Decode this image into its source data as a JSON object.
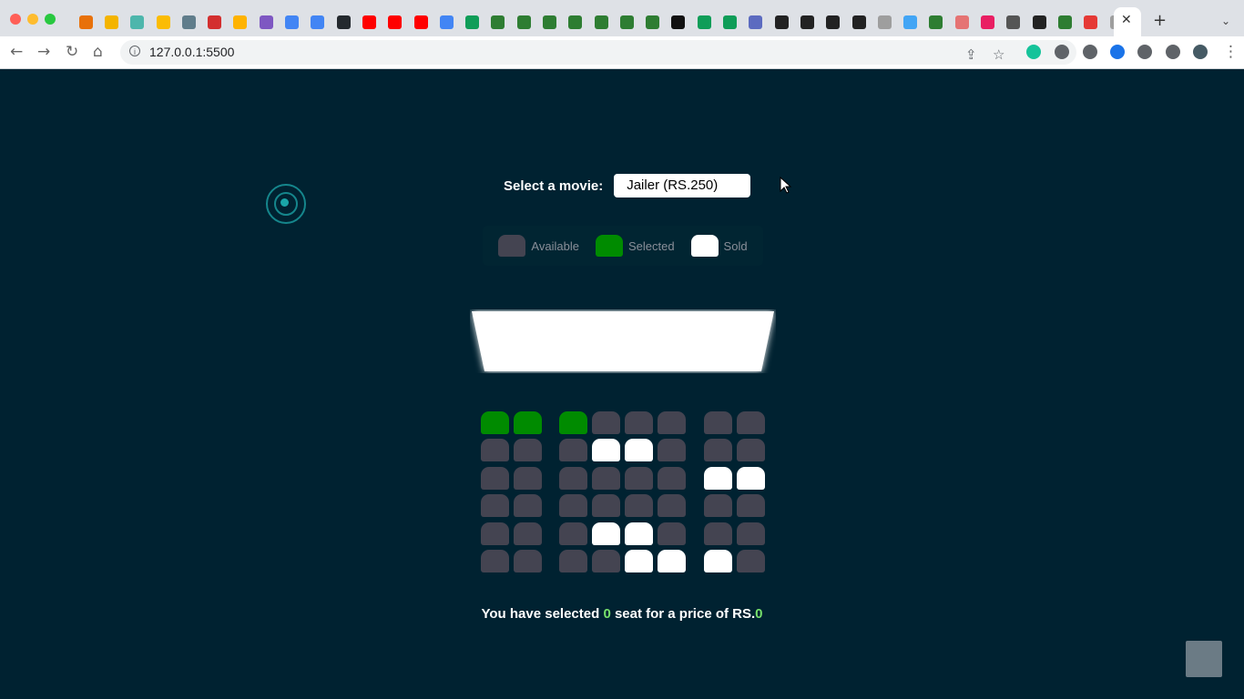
{
  "browser": {
    "url": "127.0.0.1:5500",
    "tab_icon_colors": [
      "#e8710a",
      "#f4b400",
      "#4db6ac",
      "#fbbc04",
      "#607d8b",
      "#d32f2f",
      "#ffb300",
      "#7e57c2",
      "#4285f4",
      "#4285f4",
      "#24292e",
      "#ff0000",
      "#ff0000",
      "#ff0000",
      "#4285f4",
      "#0f9d58",
      "#2e7d32",
      "#2e7d32",
      "#2e7d32",
      "#2e7d32",
      "#2e7d32",
      "#2e7d32",
      "#2e7d32",
      "#111111",
      "#0f9d58",
      "#0f9d58",
      "#5c6bc0",
      "#222222",
      "#222222",
      "#222222",
      "#222222",
      "#9e9e9e",
      "#42a5f5",
      "#2e7d32",
      "#e57373",
      "#e91e63",
      "#555555",
      "#222222",
      "#2e7d32",
      "#e53935",
      "#9e9e9e"
    ],
    "extension_colors": [
      "#15c39a",
      "#5f6368",
      "#5f6368",
      "#1a73e8",
      "#5f6368",
      "#5f6368",
      "#455a64"
    ]
  },
  "movie": {
    "label": "Select a movie:",
    "selected": "Jailer (RS.250)"
  },
  "legend": [
    {
      "label": "Available",
      "color": "#444451"
    },
    {
      "label": "Selected",
      "color": "#008b00"
    },
    {
      "label": "Sold",
      "color": "#ffffff"
    }
  ],
  "seats": {
    "rows": [
      [
        "selected",
        "selected",
        "selected",
        "available",
        "available",
        "available",
        "available",
        "available"
      ],
      [
        "available",
        "available",
        "available",
        "sold",
        "sold",
        "available",
        "available",
        "available"
      ],
      [
        "available",
        "available",
        "available",
        "available",
        "available",
        "available",
        "sold",
        "sold"
      ],
      [
        "available",
        "available",
        "available",
        "available",
        "available",
        "available",
        "available",
        "available"
      ],
      [
        "available",
        "available",
        "available",
        "sold",
        "sold",
        "available",
        "available",
        "available"
      ],
      [
        "available",
        "available",
        "available",
        "available",
        "sold",
        "sold",
        "sold",
        "available"
      ]
    ]
  },
  "summary": {
    "prefix": "You have selected ",
    "count": "0",
    "middle": " seat for a price of RS.",
    "price": "0"
  }
}
